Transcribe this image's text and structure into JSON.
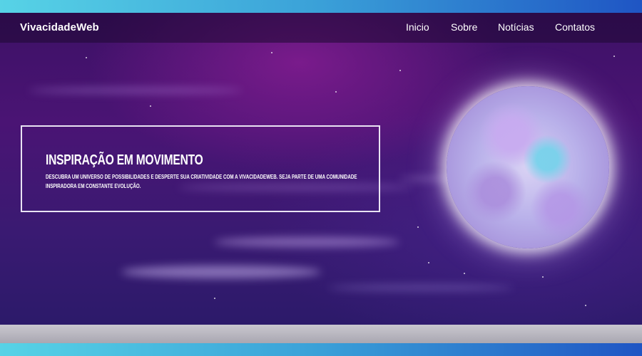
{
  "brand": "VivacidadeWeb",
  "nav": {
    "items": [
      "Inicio",
      "Sobre",
      "Notícias",
      "Contatos"
    ]
  },
  "hero": {
    "title": "Inspiração em movimento",
    "text": "Descubra um universo de possibilidades e desperte sua criatividade com a VivacidadeWeb. Seja parte de uma comunidade inspiradora em constante evolução."
  },
  "colors": {
    "frame_gradient_start": "#57d3e6",
    "frame_gradient_end": "#1f55c4",
    "background_purple": "#4a1474",
    "text": "#ffffff"
  },
  "icons": {
    "hero_image": "moon-image"
  }
}
